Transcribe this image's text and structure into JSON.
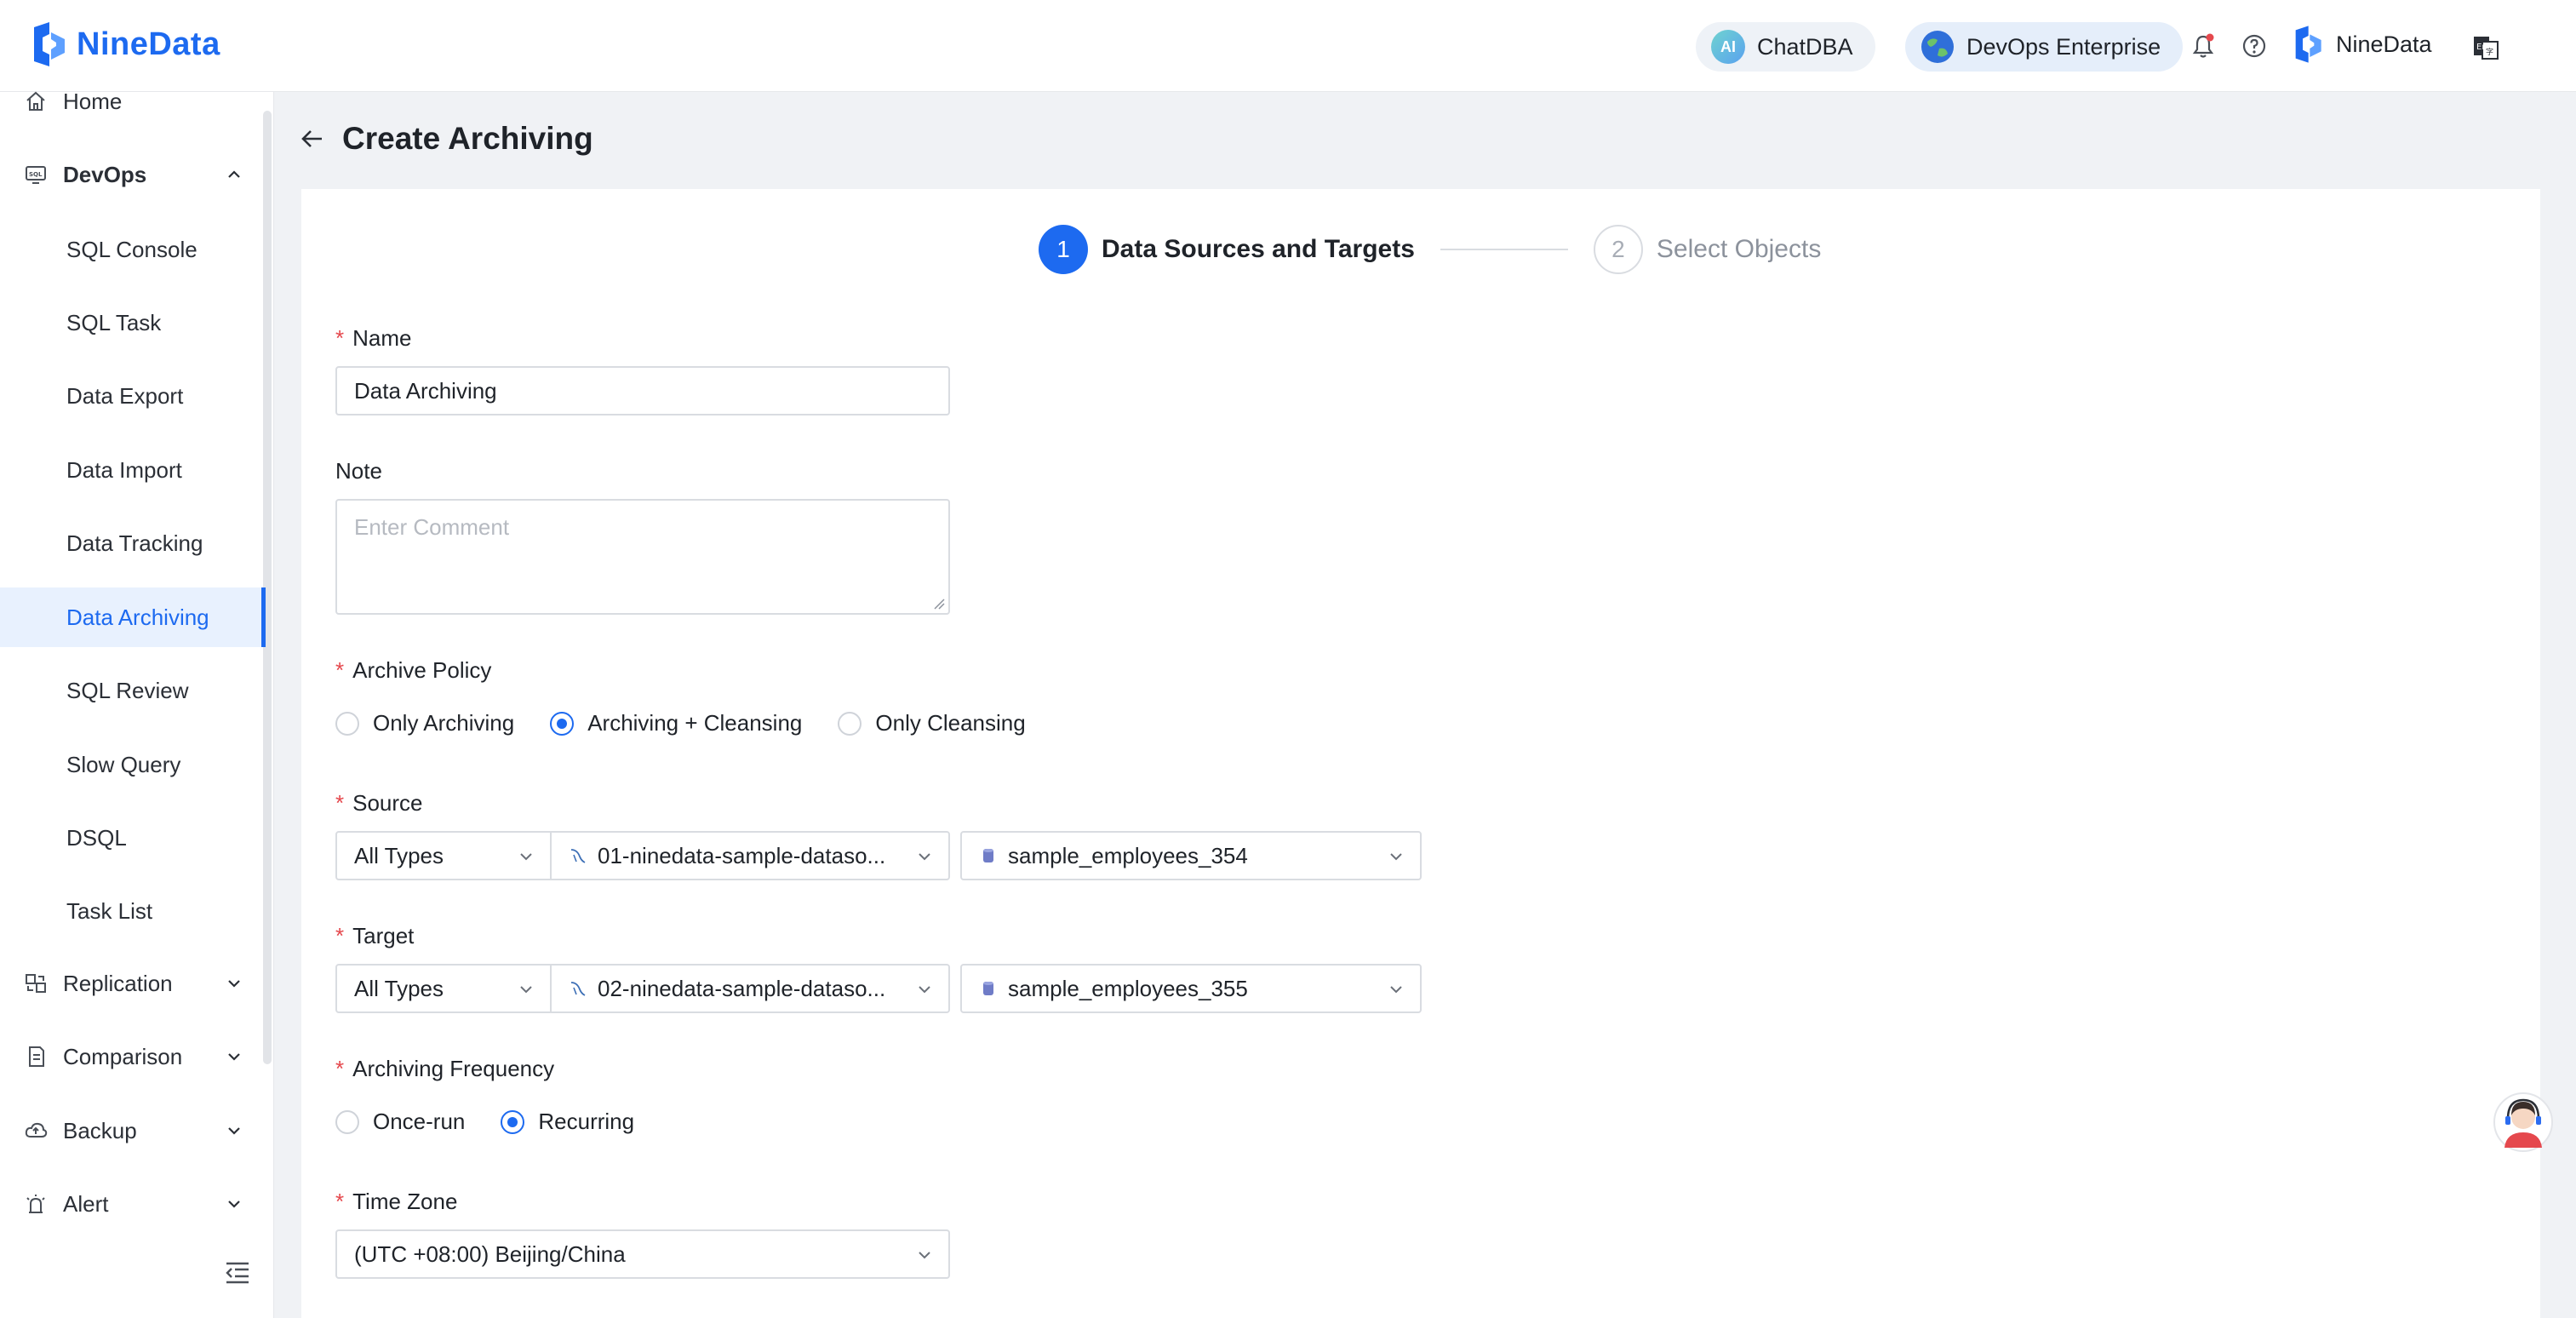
{
  "header": {
    "brand": "NineData",
    "chatdba_label": "ChatDBA",
    "chatdba_badge": "AI",
    "edition_label": "DevOps Enterprise",
    "user_name": "NineData"
  },
  "sidebar": {
    "home": "Home",
    "devops": "DevOps",
    "devops_items": [
      "SQL Console",
      "SQL Task",
      "Data Export",
      "Data Import",
      "Data Tracking",
      "Data Archiving",
      "SQL Review",
      "Slow Query",
      "DSQL",
      "Task List"
    ],
    "replication": "Replication",
    "comparison": "Comparison",
    "backup": "Backup",
    "alert": "Alert"
  },
  "page": {
    "title": "Create Archiving"
  },
  "steps": [
    {
      "num": "1",
      "label": "Data Sources and Targets"
    },
    {
      "num": "2",
      "label": "Select Objects"
    }
  ],
  "form": {
    "name_label": "Name",
    "name_value": "Data Archiving",
    "note_label": "Note",
    "note_placeholder": "Enter Comment",
    "policy_label": "Archive Policy",
    "policy_options": [
      "Only Archiving",
      "Archiving + Cleansing",
      "Only Cleansing"
    ],
    "policy_selected": "Archiving + Cleansing",
    "source_label": "Source",
    "source_type": "All Types",
    "source_datasource": "01-ninedata-sample-dataso...",
    "source_database": "sample_employees_354",
    "target_label": "Target",
    "target_type": "All Types",
    "target_datasource": "02-ninedata-sample-dataso...",
    "target_database": "sample_employees_355",
    "frequency_label": "Archiving Frequency",
    "frequency_options": [
      "Once-run",
      "Recurring"
    ],
    "frequency_selected": "Recurring",
    "timezone_label": "Time Zone",
    "timezone_value": "(UTC +08:00) Beijing/China"
  },
  "colors": {
    "accent": "#1d6af0",
    "required": "#e5484d",
    "page_bg": "#f0f2f5"
  }
}
